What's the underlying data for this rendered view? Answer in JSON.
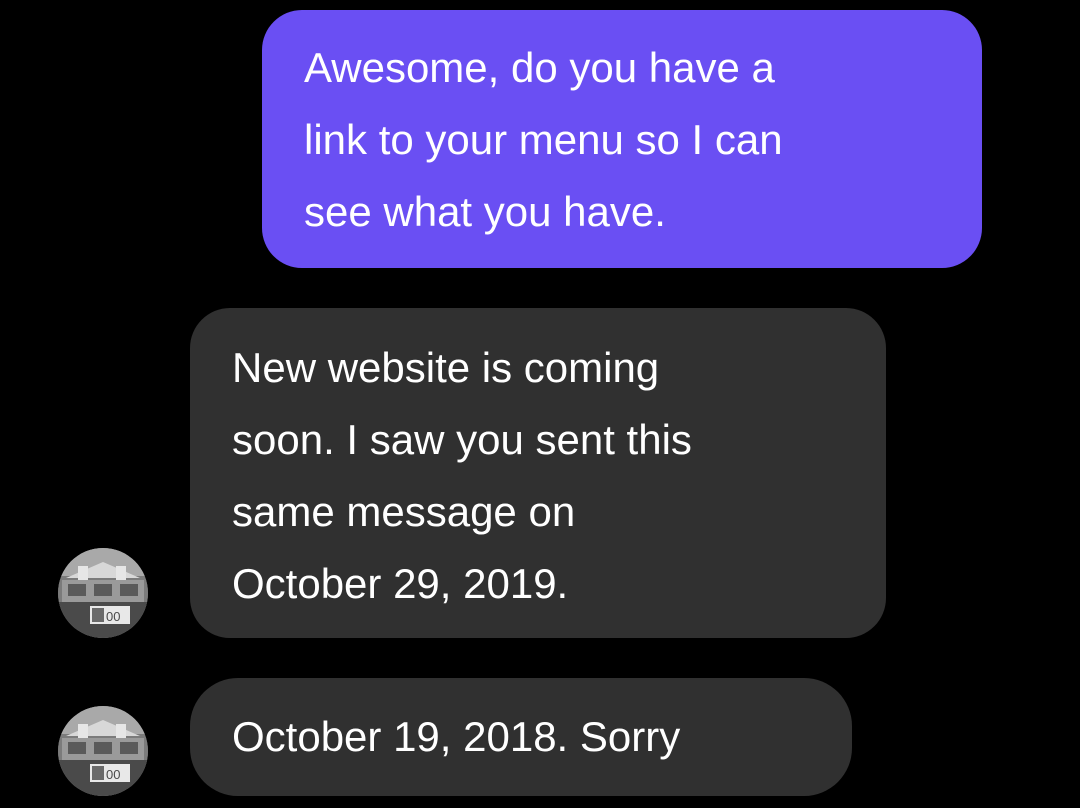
{
  "conversation": {
    "sent_message": {
      "lines": [
        "Awesome, do you have a",
        "link to your menu so I can",
        "see what you have."
      ],
      "color": "#6a4ff3"
    },
    "received_messages": [
      {
        "lines": [
          "New website is coming",
          "soon. I saw you sent this",
          "same message on",
          "October 29, 2019."
        ],
        "color": "#303030"
      },
      {
        "lines": [
          "October 19, 2018. Sorry"
        ],
        "color": "#303030"
      }
    ],
    "avatar": {
      "icon": "storefront-photo-avatar",
      "sign_text": "00"
    }
  }
}
